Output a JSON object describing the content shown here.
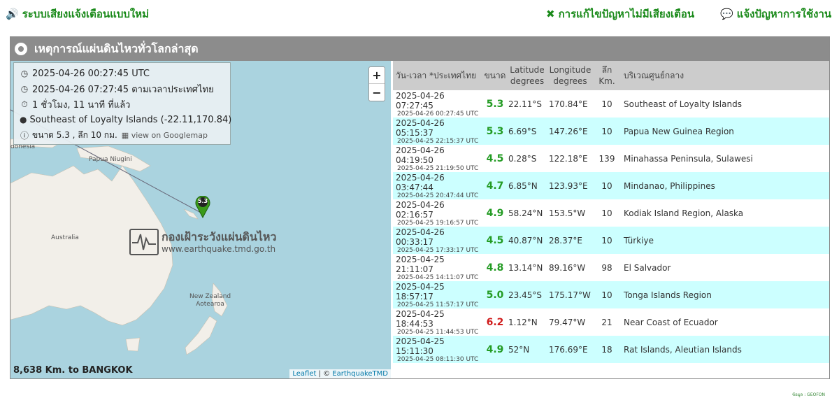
{
  "top": {
    "new_system": "ระบบเสียงแจ้งเตือนแบบใหม่",
    "fix_sound": "การแก้ไขปัญหาไม่มีเสียงเตือน",
    "report_issue": "แจ้งปัญหาการใช้งาน"
  },
  "panel": {
    "title": "เหตุการณ์แผ่นดินไหวทั่วโลกล่าสุด"
  },
  "map": {
    "info": {
      "utc_time": "2025-04-26 00:27:45 UTC",
      "thai_time": "2025-04-26 07:27:45 ตามเวลาประเทศไทย",
      "ago": "1 ชั่วโมง, 11 นาที ที่แล้ว",
      "location": "Southeast of Loyalty Islands (-22.11,170.84)",
      "magnitude_depth": "ขนาด 5.3 , ลึก 10 กม.",
      "googlemap_link": "view on Googlemap"
    },
    "zoom_in": "+",
    "zoom_out": "−",
    "labels": {
      "indonesia": "donesia",
      "papua": "Papua Niugini",
      "australia": "Australia",
      "new_zealand": "New Zealand\nAotearoa"
    },
    "marker_label": "5.3",
    "watermark": {
      "title": "กองเฝ้าระวังแผ่นดินไหว",
      "url": "www.earthquake.tmd.go.th"
    },
    "distance": "8,638 Km. to BANGKOK",
    "attribution": {
      "leaflet": "Leaflet",
      "sep": " | © ",
      "owner": "EarthquakeTMD"
    }
  },
  "table": {
    "headers": {
      "date": "วัน-เวลา *ประเทศไทย",
      "mag": "ขนาด",
      "lat": "Latitude degrees",
      "lon": "Longitude degrees",
      "depth": "ลึก Km.",
      "loc": "บริเวณศูนย์กลาง"
    },
    "rows": [
      {
        "thai": "2025-04-26 07:27:45",
        "utc": "2025-04-26 00:27:45 UTC",
        "mag": "5.3",
        "lat": "22.11°S",
        "lon": "170.84°E",
        "depth": "10",
        "loc": "Southeast of Loyalty Islands"
      },
      {
        "thai": "2025-04-26 05:15:37",
        "utc": "2025-04-25 22:15:37 UTC",
        "mag": "5.3",
        "lat": "6.69°S",
        "lon": "147.26°E",
        "depth": "10",
        "loc": "Papua New Guinea Region"
      },
      {
        "thai": "2025-04-26 04:19:50",
        "utc": "2025-04-25 21:19:50 UTC",
        "mag": "4.5",
        "lat": "0.28°S",
        "lon": "122.18°E",
        "depth": "139",
        "loc": "Minahassa Peninsula, Sulawesi"
      },
      {
        "thai": "2025-04-26 03:47:44",
        "utc": "2025-04-25 20:47:44 UTC",
        "mag": "4.7",
        "lat": "6.85°N",
        "lon": "123.93°E",
        "depth": "10",
        "loc": "Mindanao, Philippines"
      },
      {
        "thai": "2025-04-26 02:16:57",
        "utc": "2025-04-25 19:16:57 UTC",
        "mag": "4.9",
        "lat": "58.24°N",
        "lon": "153.5°W",
        "depth": "10",
        "loc": "Kodiak Island Region, Alaska"
      },
      {
        "thai": "2025-04-26 00:33:17",
        "utc": "2025-04-25 17:33:17 UTC",
        "mag": "4.5",
        "lat": "40.87°N",
        "lon": "28.37°E",
        "depth": "10",
        "loc": "Türkiye"
      },
      {
        "thai": "2025-04-25 21:11:07",
        "utc": "2025-04-25 14:11:07 UTC",
        "mag": "4.8",
        "lat": "13.14°N",
        "lon": "89.16°W",
        "depth": "98",
        "loc": "El Salvador"
      },
      {
        "thai": "2025-04-25 18:57:17",
        "utc": "2025-04-25 11:57:17 UTC",
        "mag": "5.0",
        "lat": "23.45°S",
        "lon": "175.17°W",
        "depth": "10",
        "loc": "Tonga Islands Region"
      },
      {
        "thai": "2025-04-25 18:44:53",
        "utc": "2025-04-25 11:44:53 UTC",
        "mag": "6.2",
        "lat": "1.12°N",
        "lon": "79.47°W",
        "depth": "21",
        "loc": "Near Coast of Ecuador"
      },
      {
        "thai": "2025-04-25 15:11:30",
        "utc": "2025-04-25 08:11:30 UTC",
        "mag": "4.9",
        "lat": "52°N",
        "lon": "176.69°E",
        "depth": "18",
        "loc": "Rat Islands, Aleutian Islands"
      }
    ],
    "source": "ข้อมูล : GEOFON"
  },
  "colors": {
    "green": "#239b23",
    "red": "#d01c1c",
    "header_bar": "#8c8c8c",
    "row_alt": "#ccffff",
    "sea": "#aad3df"
  }
}
